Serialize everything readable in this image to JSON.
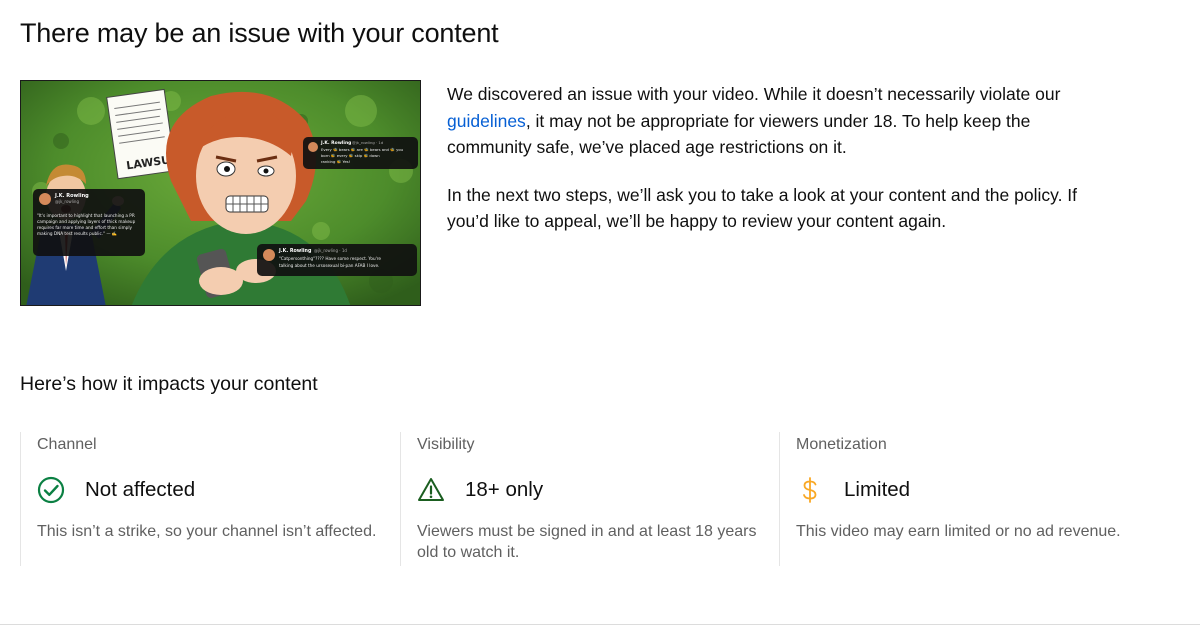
{
  "page": {
    "title": "There may be an issue with your content"
  },
  "thumbnail": {
    "lawsuit_text": "LAWSUIT",
    "tweet_left": {
      "name": "J.K. Rowling",
      "handle": "@jk_rowling",
      "lines": [
        "\"It's important to highlight that launching a PR",
        "campaign and applying layers of thick makeup",
        "requires far more time and effort than simply",
        "making DNA test results public.\" — ✍️"
      ]
    },
    "tweet_top_right": {
      "name": "J.K. Rowling",
      "handle": "@jk_rowling · 1d",
      "lines": [
        "Every 🐝 bears 🐝 are 🐝 bears and 🐝 you",
        "born 🐝 every 🐝 skip 🐝 down",
        "ranking 🐝 Yes!"
      ]
    },
    "tweet_bottom_right": {
      "name": "J.K. Rowling",
      "handle": "@jk_rowling · 1d",
      "lines": [
        "\"Catpersonthing\"???? Have some respect. You're",
        "talking about the ursosexual bi-pan AFAB I love."
      ]
    }
  },
  "description": {
    "p1_before_link": "We discovered an issue with your video. While it doesn’t necessarily violate our ",
    "link": "guidelines",
    "p1_after_link": ", it may not be appropriate for viewers under 18. To help keep the community safe, we’ve placed age restrictions on it.",
    "p2": "In the next two steps, we’ll ask you to take a look at your content and the policy. If you’d like to appeal, we’ll be happy to review your content again."
  },
  "impact": {
    "heading": "Here’s how it impacts your content",
    "columns": [
      {
        "label": "Channel",
        "status": "Not affected",
        "icon": "check-circle-icon",
        "desc": "This isn’t a strike, so your channel isn’t affected."
      },
      {
        "label": "Visibility",
        "status": "18+ only",
        "icon": "warning-triangle-icon",
        "desc": "Viewers must be signed in and at least 18 years old to watch it."
      },
      {
        "label": "Monetization",
        "status": "Limited",
        "icon": "dollar-icon",
        "desc": "This video may earn limited or no ad revenue."
      }
    ]
  },
  "colors": {
    "link": "#065fd4",
    "success": "#0b8043",
    "warning": "#1e8e3e",
    "monetization": "#f9a825",
    "secondary_text": "#606060"
  }
}
